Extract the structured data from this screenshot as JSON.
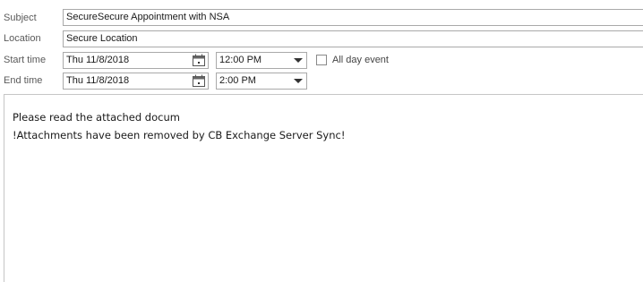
{
  "subject": {
    "label": "Subject",
    "value": "SecureSecure Appointment with NSA"
  },
  "location": {
    "label": "Location",
    "value": "Secure Location"
  },
  "start": {
    "label": "Start time",
    "date": "Thu 11/8/2018",
    "time": "12:00 PM"
  },
  "end": {
    "label": "End time",
    "date": "Thu 11/8/2018",
    "time": "2:00 PM"
  },
  "all_day": {
    "label": "All day event",
    "checked": false
  },
  "body": {
    "lines": [
      "Please read the attached docum",
      "!Attachments have been removed by CB Exchange Server Sync!"
    ]
  },
  "icons": {
    "calendar": "calendar-icon",
    "dropdown": "chevron-down-icon"
  },
  "colors": {
    "border": "#a9a9a9",
    "label": "#5a5a5a"
  }
}
